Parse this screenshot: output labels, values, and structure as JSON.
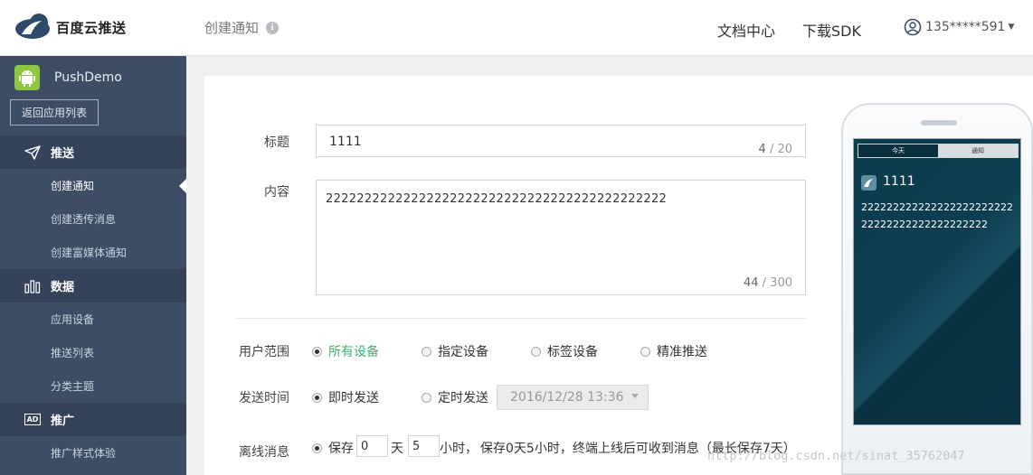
{
  "header": {
    "brand": "百度云推送",
    "page_title": "创建通知",
    "info_glyph": "i",
    "nav": [
      "文档中心",
      "下载SDK"
    ],
    "user": "135*****591",
    "accent_color": "#3cb371"
  },
  "sidebar": {
    "app_name": "PushDemo",
    "back_label": "返回应用列表",
    "sections": [
      {
        "label": "推送",
        "icon": "paper-plane-icon",
        "items": [
          "创建通知",
          "创建透传消息",
          "创建富媒体通知"
        ]
      },
      {
        "label": "数据",
        "icon": "bar-chart-icon",
        "items": [
          "应用设备",
          "推送列表",
          "分类主题"
        ]
      },
      {
        "label": "推广",
        "icon": "ad-icon",
        "items": [
          "推广样式体验"
        ]
      }
    ],
    "ad_glyph": "AD",
    "active_item": "创建通知"
  },
  "form": {
    "title_label": "标题",
    "title_value": "1111",
    "title_count": "4",
    "title_max": " / 20",
    "content_label": "内容",
    "content_value": "22222222222222222222222222222222222222222222",
    "content_count": "44",
    "content_max": " / 300",
    "scope_label": "用户范围",
    "scope_options": [
      "所有设备",
      "指定设备",
      "标签设备",
      "精准推送"
    ],
    "scope_selected": "所有设备",
    "time_label": "发送时间",
    "time_options": [
      "即时发送",
      "定时发送"
    ],
    "time_selected": "即时发送",
    "datetime_value": "2016/12/28 13:36",
    "offline_label": "离线消息",
    "offline_option": "保存",
    "offline_days": "0",
    "offline_days_unit": "天",
    "offline_hours": "5",
    "offline_hours_unit": "小时，",
    "offline_note": "保存0天5小时，终端上线后可收到消息（最长保存7天）"
  },
  "preview": {
    "tabs": [
      "今天",
      "通知"
    ],
    "title": "1111",
    "body": "22222222222222222222222222222222222222222222"
  },
  "watermark": "http://blog.csdn.net/sinat_35762047"
}
